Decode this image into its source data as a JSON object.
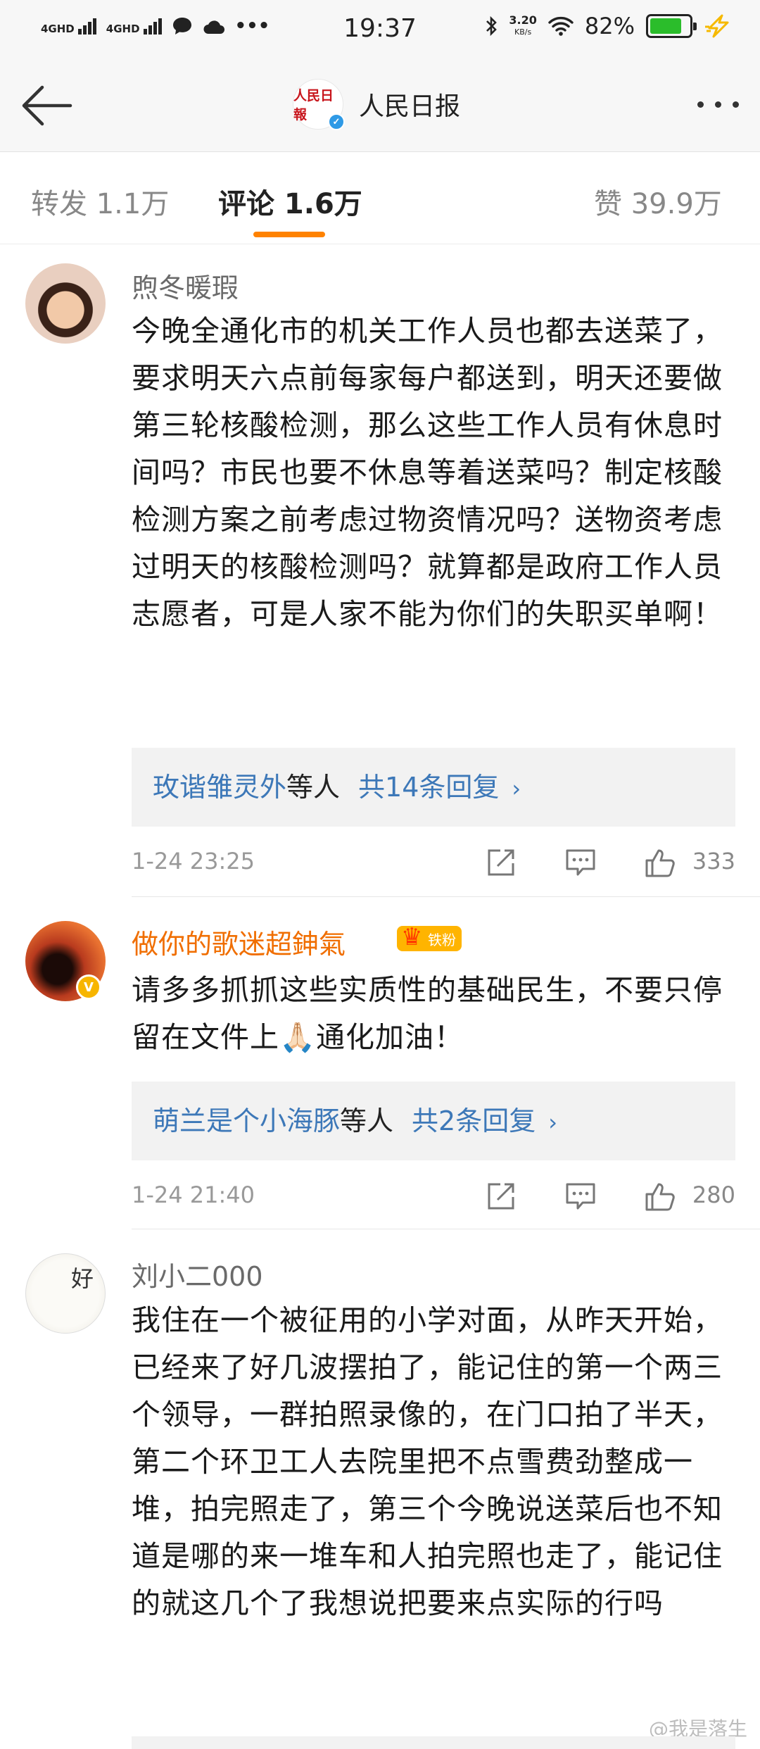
{
  "status_bar": {
    "signal_1": "4GHD",
    "signal_2": "4GHD",
    "time": "19:37",
    "speed": "3.20",
    "speed_unit": "KB/s",
    "battery": "82%",
    "battery_level": 0.82
  },
  "nav": {
    "title": "人民日报",
    "logo_text": "人民日報"
  },
  "tabs": {
    "repost": "转发 1.1万",
    "comment": "评论 1.6万",
    "like": "赞 39.9万"
  },
  "comments": [
    {
      "name": "煦冬暖瑕",
      "text": "今晚全通化市的机关工作人员也都去送菜了，要求明天六点前每家每户都送到，明天还要做第三轮核酸检测，那么这些工作人员有休息时间吗？市民也要不休息等着送菜吗？制定核酸检测方案之前考虑过物资情况吗？送物资考虑过明天的核酸检测吗？就算都是政府工作人员志愿者，可是人家不能为你们的失职买单啊！",
      "reply_who": "玫谐雏灵外",
      "reply_suffix": "等人",
      "reply_count": "共14条回复",
      "time": "1-24 23:25",
      "likes": "333"
    },
    {
      "name": "做你的歌迷超鉮氣",
      "badge": "铁粉",
      "text": "请多多抓抓这些实质性的基础民生，不要只停留在文件上🙏🏻通化加油！",
      "reply_who": "萌兰是个小海豚",
      "reply_suffix": "等人",
      "reply_count": "共2条回复",
      "time": "1-24 21:40",
      "likes": "280"
    },
    {
      "name": "刘小二000",
      "text": "我住在一个被征用的小学对面，从昨天开始，已经来了好几波摆拍了，能记住的第一个两三个领导，一群拍照录像的，在门口拍了半天，第二个环卫工人去院里把不点雪费劲整成一堆，拍完照走了，第三个今晚说送菜后也不知道是哪的来一堆车和人拍完照也走了，能记住的就这几个了我想说把要来点实际的行吗",
      "avatar_char": "好"
    }
  ],
  "watermark": "@我是落生"
}
